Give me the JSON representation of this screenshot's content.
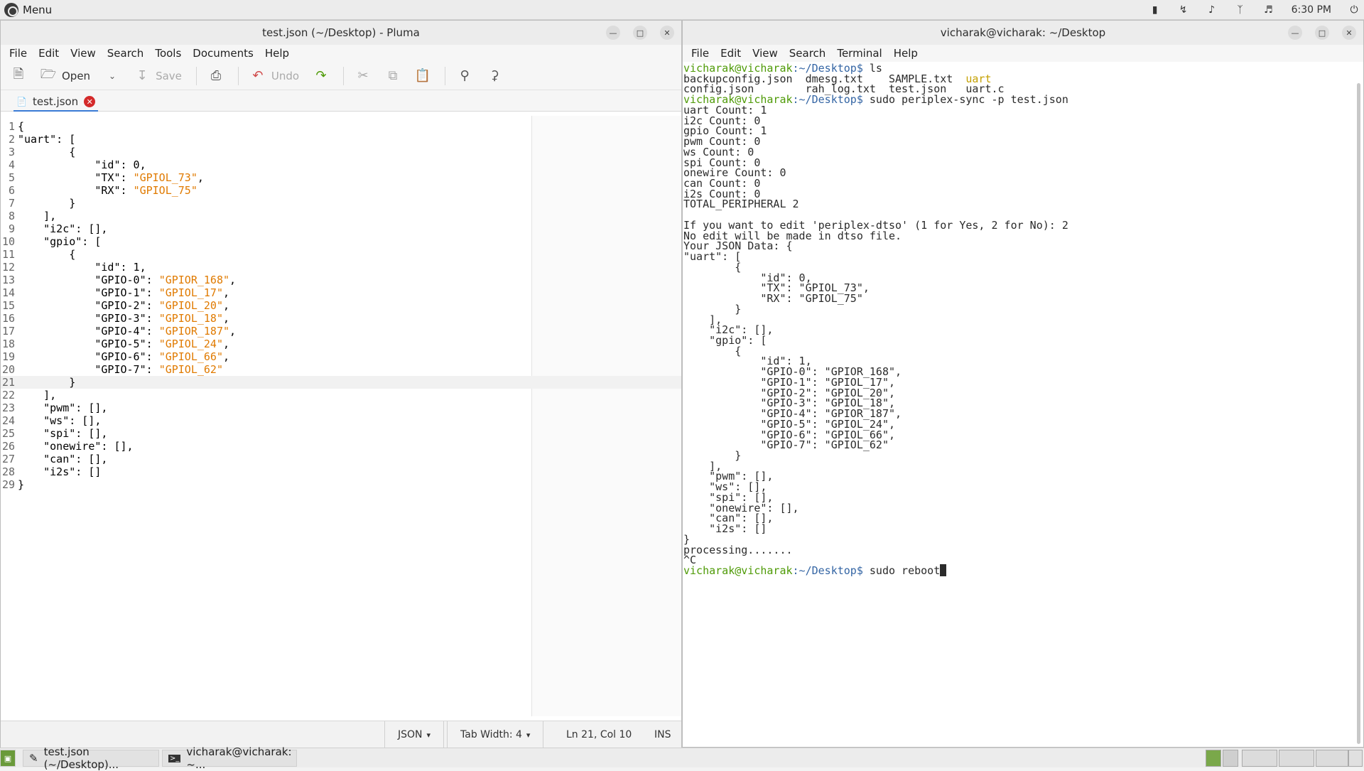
{
  "top_panel": {
    "menu_label": "Menu",
    "clock": "6:30 PM"
  },
  "pluma": {
    "title": "test.json (~/Desktop) - Pluma",
    "menu": [
      "File",
      "Edit",
      "View",
      "Search",
      "Tools",
      "Documents",
      "Help"
    ],
    "toolbar": {
      "open": "Open",
      "save": "Save",
      "undo": "Undo"
    },
    "tab_label": "test.json",
    "status": {
      "language": "JSON",
      "tab_width": "Tab Width: 4",
      "position": "Ln 21, Col 10",
      "mode": "INS"
    }
  },
  "editor_lines": [
    {
      "n": "1",
      "code": "{",
      "s": "",
      "tail": ""
    },
    {
      "n": "2",
      "code": "\"uart\": [",
      "s": "",
      "tail": ""
    },
    {
      "n": "3",
      "code": "        {",
      "s": "",
      "tail": ""
    },
    {
      "n": "4",
      "code": "            \"id\": 0,",
      "s": "",
      "tail": ""
    },
    {
      "n": "5",
      "code": "            \"TX\": ",
      "s": "\"GPIOL_73\"",
      "tail": ","
    },
    {
      "n": "6",
      "code": "            \"RX\": ",
      "s": "\"GPIOL_75\"",
      "tail": ""
    },
    {
      "n": "7",
      "code": "        }",
      "s": "",
      "tail": ""
    },
    {
      "n": "8",
      "code": "    ],",
      "s": "",
      "tail": ""
    },
    {
      "n": "9",
      "code": "    \"i2c\": [],",
      "s": "",
      "tail": ""
    },
    {
      "n": "10",
      "code": "    \"gpio\": [",
      "s": "",
      "tail": ""
    },
    {
      "n": "11",
      "code": "        {",
      "s": "",
      "tail": ""
    },
    {
      "n": "12",
      "code": "            \"id\": 1,",
      "s": "",
      "tail": ""
    },
    {
      "n": "13",
      "code": "            \"GPIO-0\": ",
      "s": "\"GPIOR_168\"",
      "tail": ","
    },
    {
      "n": "14",
      "code": "            \"GPIO-1\": ",
      "s": "\"GPIOL_17\"",
      "tail": ","
    },
    {
      "n": "15",
      "code": "            \"GPIO-2\": ",
      "s": "\"GPIOL_20\"",
      "tail": ","
    },
    {
      "n": "16",
      "code": "            \"GPIO-3\": ",
      "s": "\"GPIOL_18\"",
      "tail": ","
    },
    {
      "n": "17",
      "code": "            \"GPIO-4\": ",
      "s": "\"GPIOR_187\"",
      "tail": ","
    },
    {
      "n": "18",
      "code": "            \"GPIO-5\": ",
      "s": "\"GPIOL_24\"",
      "tail": ","
    },
    {
      "n": "19",
      "code": "            \"GPIO-6\": ",
      "s": "\"GPIOL_66\"",
      "tail": ","
    },
    {
      "n": "20",
      "code": "            \"GPIO-7\": ",
      "s": "\"GPIOL_62\"",
      "tail": ""
    },
    {
      "n": "21",
      "code": "        }",
      "s": "",
      "tail": ""
    },
    {
      "n": "22",
      "code": "    ],",
      "s": "",
      "tail": ""
    },
    {
      "n": "23",
      "code": "    \"pwm\": [],",
      "s": "",
      "tail": ""
    },
    {
      "n": "24",
      "code": "    \"ws\": [],",
      "s": "",
      "tail": ""
    },
    {
      "n": "25",
      "code": "    \"spi\": [],",
      "s": "",
      "tail": ""
    },
    {
      "n": "26",
      "code": "    \"onewire\": [],",
      "s": "",
      "tail": ""
    },
    {
      "n": "27",
      "code": "    \"can\": [],",
      "s": "",
      "tail": ""
    },
    {
      "n": "28",
      "code": "    \"i2s\": []",
      "s": "",
      "tail": ""
    },
    {
      "n": "29",
      "code": "}",
      "s": "",
      "tail": ""
    }
  ],
  "terminal": {
    "title": "vicharak@vicharak: ~/Desktop",
    "menu": [
      "File",
      "Edit",
      "View",
      "Search",
      "Terminal",
      "Help"
    ],
    "prompt_user": "vicharak@vicharak",
    "prompt_path": ":~/Desktop$",
    "lines": [
      {
        "p": true,
        "t": " ls",
        "hl": ""
      },
      {
        "p": false,
        "t": "backupconfig.json  dmesg.txt    SAMPLE.txt  ",
        "hl": "uart"
      },
      {
        "p": false,
        "t": "config.json        rah_log.txt  test.json   uart.c",
        "hl": ""
      },
      {
        "p": true,
        "t": " sudo periplex-sync -p test.json",
        "hl": ""
      },
      {
        "p": false,
        "t": "uart Count: 1",
        "hl": ""
      },
      {
        "p": false,
        "t": "i2c Count: 0",
        "hl": ""
      },
      {
        "p": false,
        "t": "gpio Count: 1",
        "hl": ""
      },
      {
        "p": false,
        "t": "pwm Count: 0",
        "hl": ""
      },
      {
        "p": false,
        "t": "ws Count: 0",
        "hl": ""
      },
      {
        "p": false,
        "t": "spi Count: 0",
        "hl": ""
      },
      {
        "p": false,
        "t": "onewire Count: 0",
        "hl": ""
      },
      {
        "p": false,
        "t": "can Count: 0",
        "hl": ""
      },
      {
        "p": false,
        "t": "i2s Count: 0",
        "hl": ""
      },
      {
        "p": false,
        "t": "TOTAL_PERIPHERAL 2",
        "hl": ""
      },
      {
        "p": false,
        "t": "",
        "hl": ""
      },
      {
        "p": false,
        "t": "If you want to edit 'periplex-dtso' (1 for Yes, 2 for No): 2",
        "hl": ""
      },
      {
        "p": false,
        "t": "No edit will be made in dtso file.",
        "hl": ""
      },
      {
        "p": false,
        "t": "Your JSON Data: {",
        "hl": ""
      },
      {
        "p": false,
        "t": "\"uart\": [",
        "hl": ""
      },
      {
        "p": false,
        "t": "        {",
        "hl": ""
      },
      {
        "p": false,
        "t": "            \"id\": 0,",
        "hl": ""
      },
      {
        "p": false,
        "t": "            \"TX\": \"GPIOL_73\",",
        "hl": ""
      },
      {
        "p": false,
        "t": "            \"RX\": \"GPIOL_75\"",
        "hl": ""
      },
      {
        "p": false,
        "t": "        }",
        "hl": ""
      },
      {
        "p": false,
        "t": "    ],",
        "hl": ""
      },
      {
        "p": false,
        "t": "    \"i2c\": [],",
        "hl": ""
      },
      {
        "p": false,
        "t": "    \"gpio\": [",
        "hl": ""
      },
      {
        "p": false,
        "t": "        {",
        "hl": ""
      },
      {
        "p": false,
        "t": "            \"id\": 1,",
        "hl": ""
      },
      {
        "p": false,
        "t": "            \"GPIO-0\": \"GPIOR_168\",",
        "hl": ""
      },
      {
        "p": false,
        "t": "            \"GPIO-1\": \"GPIOL_17\",",
        "hl": ""
      },
      {
        "p": false,
        "t": "            \"GPIO-2\": \"GPIOL_20\",",
        "hl": ""
      },
      {
        "p": false,
        "t": "            \"GPIO-3\": \"GPIOL_18\",",
        "hl": ""
      },
      {
        "p": false,
        "t": "            \"GPIO-4\": \"GPIOR_187\",",
        "hl": ""
      },
      {
        "p": false,
        "t": "            \"GPIO-5\": \"GPIOL_24\",",
        "hl": ""
      },
      {
        "p": false,
        "t": "            \"GPIO-6\": \"GPIOL_66\",",
        "hl": ""
      },
      {
        "p": false,
        "t": "            \"GPIO-7\": \"GPIOL_62\"",
        "hl": ""
      },
      {
        "p": false,
        "t": "        }",
        "hl": ""
      },
      {
        "p": false,
        "t": "    ],",
        "hl": ""
      },
      {
        "p": false,
        "t": "    \"pwm\": [],",
        "hl": ""
      },
      {
        "p": false,
        "t": "    \"ws\": [],",
        "hl": ""
      },
      {
        "p": false,
        "t": "    \"spi\": [],",
        "hl": ""
      },
      {
        "p": false,
        "t": "    \"onewire\": [],",
        "hl": ""
      },
      {
        "p": false,
        "t": "    \"can\": [],",
        "hl": ""
      },
      {
        "p": false,
        "t": "    \"i2s\": []",
        "hl": ""
      },
      {
        "p": false,
        "t": "}",
        "hl": ""
      },
      {
        "p": false,
        "t": "processing.......",
        "hl": ""
      },
      {
        "p": false,
        "t": "^C",
        "hl": ""
      },
      {
        "p": true,
        "t": " sudo reboot",
        "hl": "",
        "cursor": true
      }
    ]
  },
  "taskbar": {
    "tasks": [
      "test.json (~/Desktop)...",
      "vicharak@vicharak: ~..."
    ]
  },
  "colors": {
    "prompt": "#4e9a06",
    "string": "#e07a00",
    "close_button": "#d42a2a",
    "ls_executable": "#4e9a06"
  }
}
